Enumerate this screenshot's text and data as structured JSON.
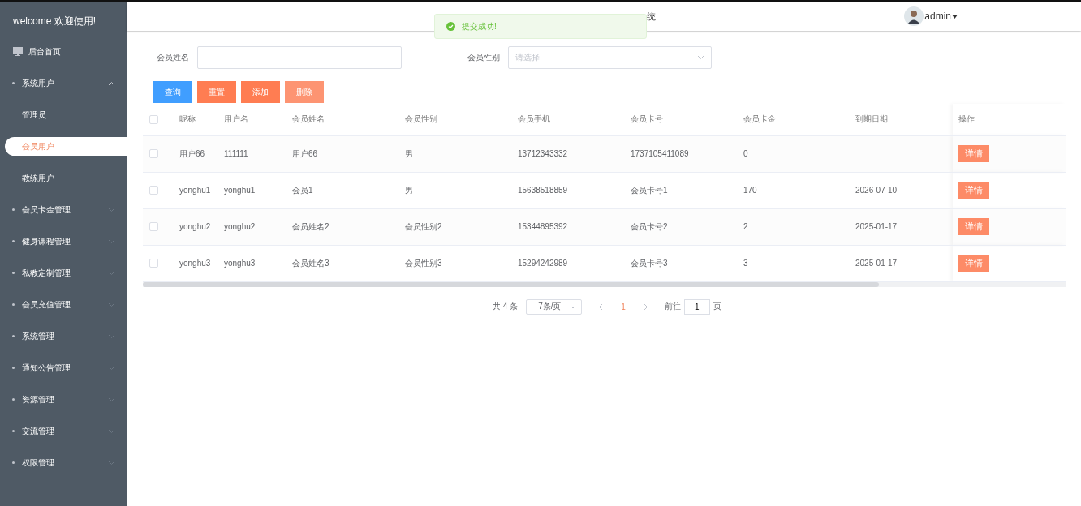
{
  "sidebar": {
    "welcome": "welcome 欢迎使用!",
    "items": [
      {
        "kind": "home",
        "label": "后台首页"
      },
      {
        "kind": "group",
        "label": "系统用户",
        "expanded": true,
        "children": [
          {
            "label": "管理员",
            "selected": false
          },
          {
            "label": "会员用户",
            "selected": true
          },
          {
            "label": "教练用户",
            "selected": false
          }
        ]
      },
      {
        "kind": "group",
        "label": "会员卡金管理",
        "expanded": false
      },
      {
        "kind": "group",
        "label": "健身课程管理",
        "expanded": false
      },
      {
        "kind": "group",
        "label": "私教定制管理",
        "expanded": false
      },
      {
        "kind": "group",
        "label": "会员充值管理",
        "expanded": false
      },
      {
        "kind": "group",
        "label": "系统管理",
        "expanded": false
      },
      {
        "kind": "group",
        "label": "通知公告管理",
        "expanded": false
      },
      {
        "kind": "group",
        "label": "资源管理",
        "expanded": false
      },
      {
        "kind": "group",
        "label": "交流管理",
        "expanded": false
      },
      {
        "kind": "group",
        "label": "权限管理",
        "expanded": false
      }
    ]
  },
  "header": {
    "title": "统",
    "user": "admin"
  },
  "toast": {
    "message": "提交成功!"
  },
  "search": {
    "name_label": "会员姓名",
    "gender_label": "会员性别",
    "gender_placeholder": "请选择"
  },
  "buttons": [
    {
      "label": "查询",
      "kind": "primary",
      "disabled": false
    },
    {
      "label": "重置",
      "kind": "warning",
      "disabled": false
    },
    {
      "label": "添加",
      "kind": "warning",
      "disabled": false
    },
    {
      "label": "删除",
      "kind": "warning",
      "disabled": true
    }
  ],
  "table": {
    "select_all_checked": false,
    "columns": [
      "昵称",
      "用户名",
      "会员姓名",
      "会员性别",
      "会员手机",
      "会员卡号",
      "会员卡金",
      "到期日期",
      "操作"
    ],
    "rows": [
      {
        "checked": false,
        "cells": [
          "用户66",
          "111111",
          "用户66",
          "男",
          "13712343332",
          "1737105411089",
          "0",
          ""
        ],
        "action": "详情"
      },
      {
        "checked": false,
        "cells": [
          "yonghu1",
          "yonghu1",
          "会员1",
          "男",
          "15638518859",
          "会员卡号1",
          "170",
          "2026-07-10"
        ],
        "action": "详情"
      },
      {
        "checked": false,
        "cells": [
          "yonghu2",
          "yonghu2",
          "会员姓名2",
          "会员性别2",
          "15344895392",
          "会员卡号2",
          "2",
          "2025-01-17"
        ],
        "action": "详情"
      },
      {
        "checked": false,
        "cells": [
          "yonghu3",
          "yonghu3",
          "会员姓名3",
          "会员性别3",
          "15294242989",
          "会员卡号3",
          "3",
          "2025-01-17"
        ],
        "action": "详情"
      }
    ]
  },
  "pagination": {
    "total": "共 4 条",
    "page_size": "7条/页",
    "pages": [
      {
        "label": "1",
        "selected": true
      }
    ],
    "goto_label": "前往",
    "goto_value": "1",
    "page_unit": "页"
  }
}
